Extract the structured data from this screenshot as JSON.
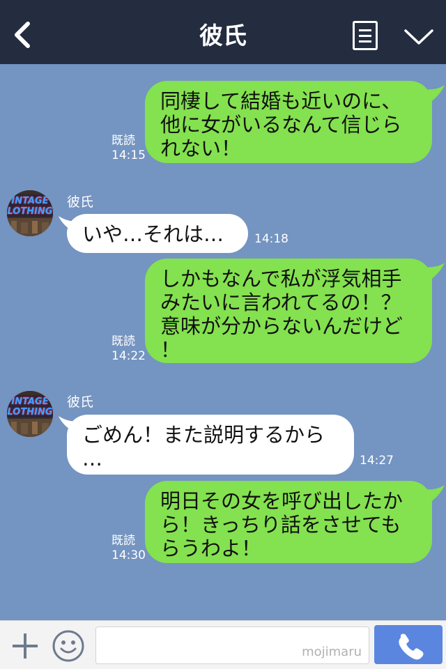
{
  "header": {
    "back_icon": "chevron-left-icon",
    "title": "彼氏",
    "memo_icon": "note-icon",
    "menu_icon": "chevron-down-icon"
  },
  "messages": [
    {
      "side": "right",
      "text": "同棲して結婚も近いのに、\n他に女がいるなんて信じら\nれない！",
      "read": "既読",
      "time": "14:15"
    },
    {
      "side": "left",
      "sender": "彼氏",
      "avatar_text": "INTAGE\nLOTHING",
      "text": "いや…それは…",
      "time": "14:18"
    },
    {
      "side": "right",
      "text": "しかもなんで私が浮気相手\nみたいに言われてるの！？\n意味が分からないんだけど\n！",
      "read": "既読",
      "time": "14:22"
    },
    {
      "side": "left",
      "sender": "彼氏",
      "avatar_text": "INTAGE\nLOTHING",
      "text": "ごめん！また説明するから\n…",
      "time": "14:27"
    },
    {
      "side": "right",
      "text": "明日その女を呼び出したか\nら！きっちり話をさせても\nらうわよ！",
      "read": "既読",
      "time": "14:30"
    }
  ],
  "input_bar": {
    "plus_icon": "plus-icon",
    "emoji_icon": "smiley-icon",
    "watermark": "mojimaru",
    "call_icon": "phone-icon"
  },
  "colors": {
    "header_bg": "#242c40",
    "chat_bg": "#7494c1",
    "my_bubble": "#84e14f",
    "their_bubble": "#ffffff",
    "call_button": "#5a86e0"
  }
}
